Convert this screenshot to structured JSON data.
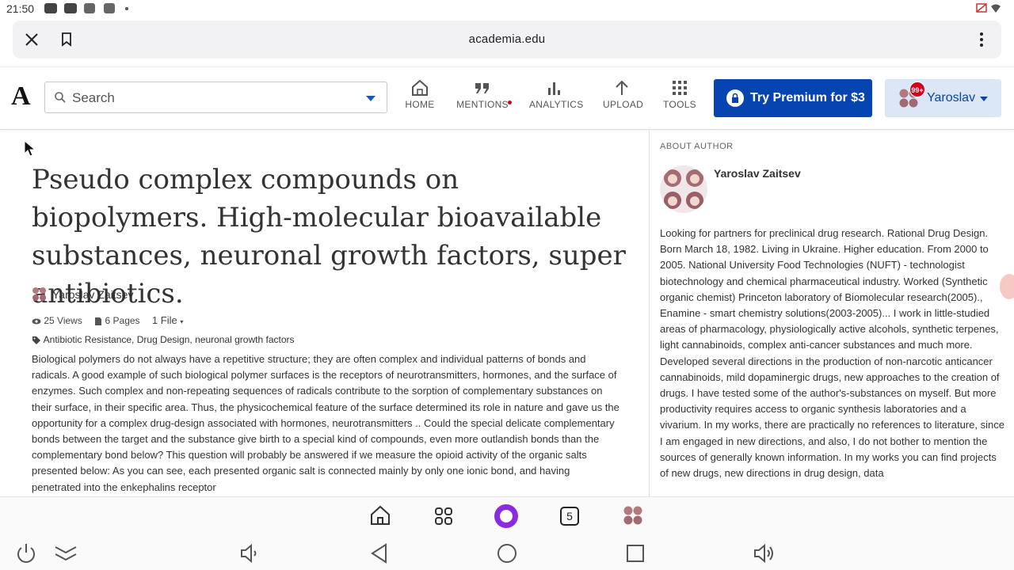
{
  "status_bar": {
    "time": "21:50"
  },
  "browser": {
    "url": "academia.edu"
  },
  "header": {
    "logo": "A",
    "search_placeholder": "Search",
    "nav": [
      {
        "label": "HOME",
        "icon": "home-icon"
      },
      {
        "label": "MENTIONS",
        "icon": "quote-icon"
      },
      {
        "label": "ANALYTICS",
        "icon": "bar-chart-icon"
      },
      {
        "label": "UPLOAD",
        "icon": "upload-icon"
      },
      {
        "label": "TOOLS",
        "icon": "grid-icon"
      }
    ],
    "premium_label": "Try Premium for $3",
    "user_name": "Yaroslav",
    "notification_badge": "99+"
  },
  "paper": {
    "title": "Pseudo complex compounds on biopolymers. High-molecular bioavailable substances, neuronal growth factors, super antibiotics.",
    "author": "Yaroslav Zaitsev",
    "views": "25 Views",
    "pages": "6 Pages",
    "files": "1 File",
    "tags": "Antibiotic Resistance, Drug Design, neuronal growth factors",
    "abstract": "Biological polymers do not always have a repetitive structure; they are often complex and individual patterns of bonds and radicals. A good example of such biological polymer surfaces is the receptors of neurotransmitters, hormones, and the surface of enzymes. Such complex and non-repeating sequences of radicals contribute to the sorption of complementary substances on their surface, in their specific area. Thus, the physicochemical feature of the surface determined its role in nature and gave us the opportunity for a complex drug-design associated with hormones, neurotransmitters .. Could the special delicate complementary bonds between the target and the substance give birth to a special kind of compounds, even more outlandish bonds than the complementary bond below? This question will probably be answered if we measure the opioid activity of the organic salts presented below: As you can see, each presented organic salt is connected mainly by only one ionic bond, and having penetrated into the enkephalins receptor"
  },
  "about_author": {
    "heading": "ABOUT AUTHOR",
    "name": "Yaroslav Zaitsev",
    "bio": "Looking for partners for preclinical drug research. Rational Drug Design. Born March 18, 1982. Living in Ukraine. Higher education. From 2000 to 2005. National University Food Technologies (NUFT) - technologist biotechnology and chemical pharmaceutical industry. Worked (Synthetic organic chemist) Princeton laboratory of Biomolecular research(2005)., Enamine - smart chemistry solutions(2003-2005)... I work in little-studied areas of pharmacology, physiologically active alcohols, synthetic terpenes, light cannabinoids, complex anti-cancer substances and much more. Developed several directions in the production of non-narcotic anticancer cannabinoids, mild dopaminergic drugs, new approaches to the creation of drugs. I have tested some of the author's-substances on myself. But more productivity requires access to organic synthesis laboratories and a vivarium. In my works, there are practically no references to literature, since I am engaged in new directions, and also, I do not bother to mention the sources of generally known information. In my works you can find projects of new drugs, new directions in drug design, data"
  },
  "android_nav": {
    "tabs_count": "5"
  },
  "colors": {
    "brand_blue": "#0645b1",
    "badge_red": "#d0021b",
    "assistant_purple": "#8a2be2"
  }
}
